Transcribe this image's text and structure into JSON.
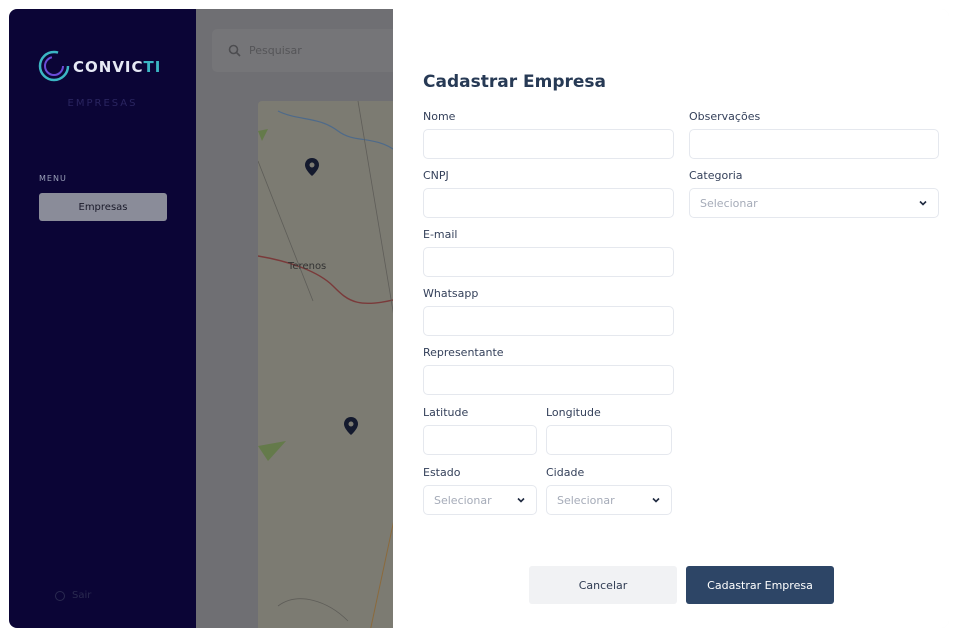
{
  "sidebar": {
    "logo_text_main": "CONVIC",
    "logo_text_accent": "TI",
    "logo_subtitle": "EMPRESAS",
    "menu_label": "MENU",
    "menu_items": [
      {
        "label": "Empresas"
      }
    ],
    "logout_label": "Sair"
  },
  "main": {
    "search_placeholder": "Pesquisar",
    "map_place_label": "Terenos"
  },
  "form": {
    "title": "Cadastrar Empresa",
    "fields": {
      "nome": {
        "label": "Nome",
        "value": ""
      },
      "observacoes": {
        "label": "Observações",
        "value": ""
      },
      "cnpj": {
        "label": "CNPJ",
        "value": ""
      },
      "categoria": {
        "label": "Categoria",
        "selected": "Selecionar"
      },
      "email": {
        "label": "E-mail",
        "value": ""
      },
      "whatsapp": {
        "label": "Whatsapp",
        "value": ""
      },
      "representante": {
        "label": "Representante",
        "value": ""
      },
      "latitude": {
        "label": "Latitude",
        "value": ""
      },
      "longitude": {
        "label": "Longitude",
        "value": ""
      },
      "estado": {
        "label": "Estado",
        "selected": "Selecionar"
      },
      "cidade": {
        "label": "Cidade",
        "selected": "Selecionar"
      }
    },
    "cancel_label": "Cancelar",
    "submit_label": "Cadastrar Empresa"
  },
  "colors": {
    "sidebar_bg": "#0b0536",
    "accent": "#3bb6c4",
    "primary_button": "#2d4566",
    "title_text": "#273a55"
  }
}
